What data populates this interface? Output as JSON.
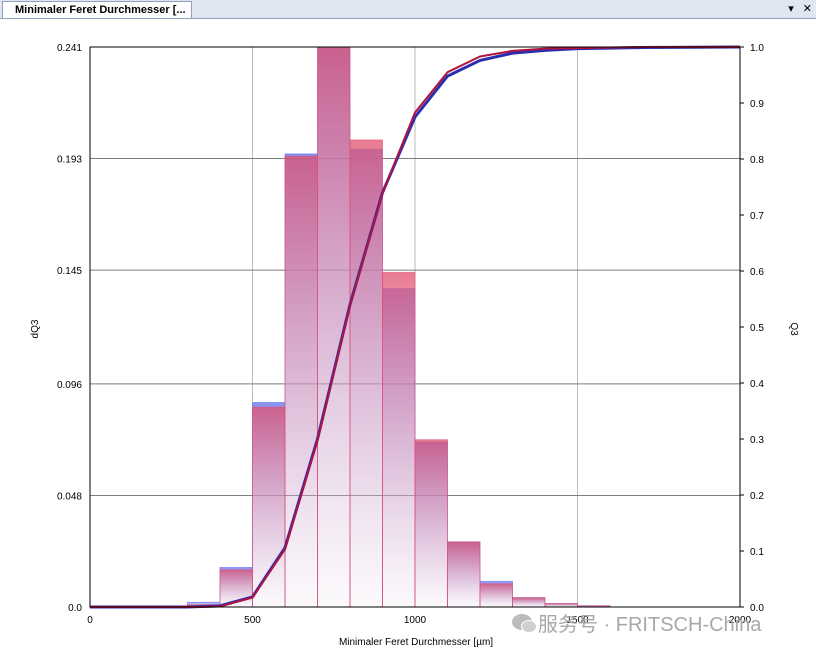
{
  "tab": {
    "title": "Minimaler Feret Durchmesser [...",
    "dropdown_icon": "chevron-down-icon",
    "close_icon": "close-icon"
  },
  "chart_data": {
    "type": "bar",
    "xlabel": "Minimaler Feret Durchmesser [µm]",
    "ylabel": "dQ3",
    "y2label": "Q3",
    "xlim": [
      0,
      2000
    ],
    "ylim": [
      0,
      0.241
    ],
    "y2lim": [
      0,
      1.0
    ],
    "xticks": [
      "0",
      "500",
      "1000",
      "1500",
      "2000"
    ],
    "yticks": [
      "0.0",
      "0.048",
      "0.096",
      "0.145",
      "0.193",
      "0.241"
    ],
    "y2ticks": [
      "0.0",
      "0.1",
      "0.2",
      "0.3",
      "0.4",
      "0.5",
      "0.6",
      "0.7",
      "0.8",
      "0.9",
      "1.0"
    ],
    "grid": true,
    "bin_edges": [
      0,
      100,
      200,
      300,
      400,
      500,
      600,
      700,
      800,
      900,
      1000,
      1100,
      1200,
      1300,
      1400,
      1500,
      1600,
      1700,
      1800,
      1900,
      2000
    ],
    "series": [
      {
        "color": "#5a6cf0",
        "dq3": [
          0,
          0,
          0,
          0.002,
          0.017,
          0.088,
          0.195,
          0.241,
          0.197,
          0.137,
          0.071,
          0.028,
          0.011,
          0.004,
          0.0015,
          0.0005,
          0,
          0,
          0,
          0
        ],
        "q3_x": [
          0,
          300,
          400,
          500,
          600,
          700,
          800,
          900,
          1000,
          1100,
          1200,
          1300,
          1400,
          1500,
          1600,
          1700,
          2000
        ],
        "q3": [
          0,
          0.0,
          0.002,
          0.018,
          0.106,
          0.3,
          0.54,
          0.74,
          0.875,
          0.948,
          0.976,
          0.989,
          0.994,
          0.997,
          0.998,
          0.999,
          1.0
        ]
      },
      {
        "color": "#e84a6a",
        "dq3": [
          0,
          0,
          0,
          0.001,
          0.016,
          0.086,
          0.194,
          0.241,
          0.201,
          0.144,
          0.072,
          0.028,
          0.01,
          0.004,
          0.0015,
          0.0005,
          0,
          0,
          0,
          0
        ],
        "q3_x": [
          0,
          300,
          400,
          500,
          600,
          700,
          800,
          900,
          1000,
          1100,
          1200,
          1300,
          1400,
          1500,
          1600,
          1700,
          2000
        ],
        "q3": [
          0,
          0.0,
          0.001,
          0.017,
          0.103,
          0.297,
          0.538,
          0.739,
          0.883,
          0.955,
          0.983,
          0.993,
          0.997,
          0.998,
          0.999,
          1.0,
          1.0
        ]
      }
    ]
  },
  "watermark": {
    "text": "服务号 · FRITSCH-China",
    "icon": "wechat-icon"
  }
}
